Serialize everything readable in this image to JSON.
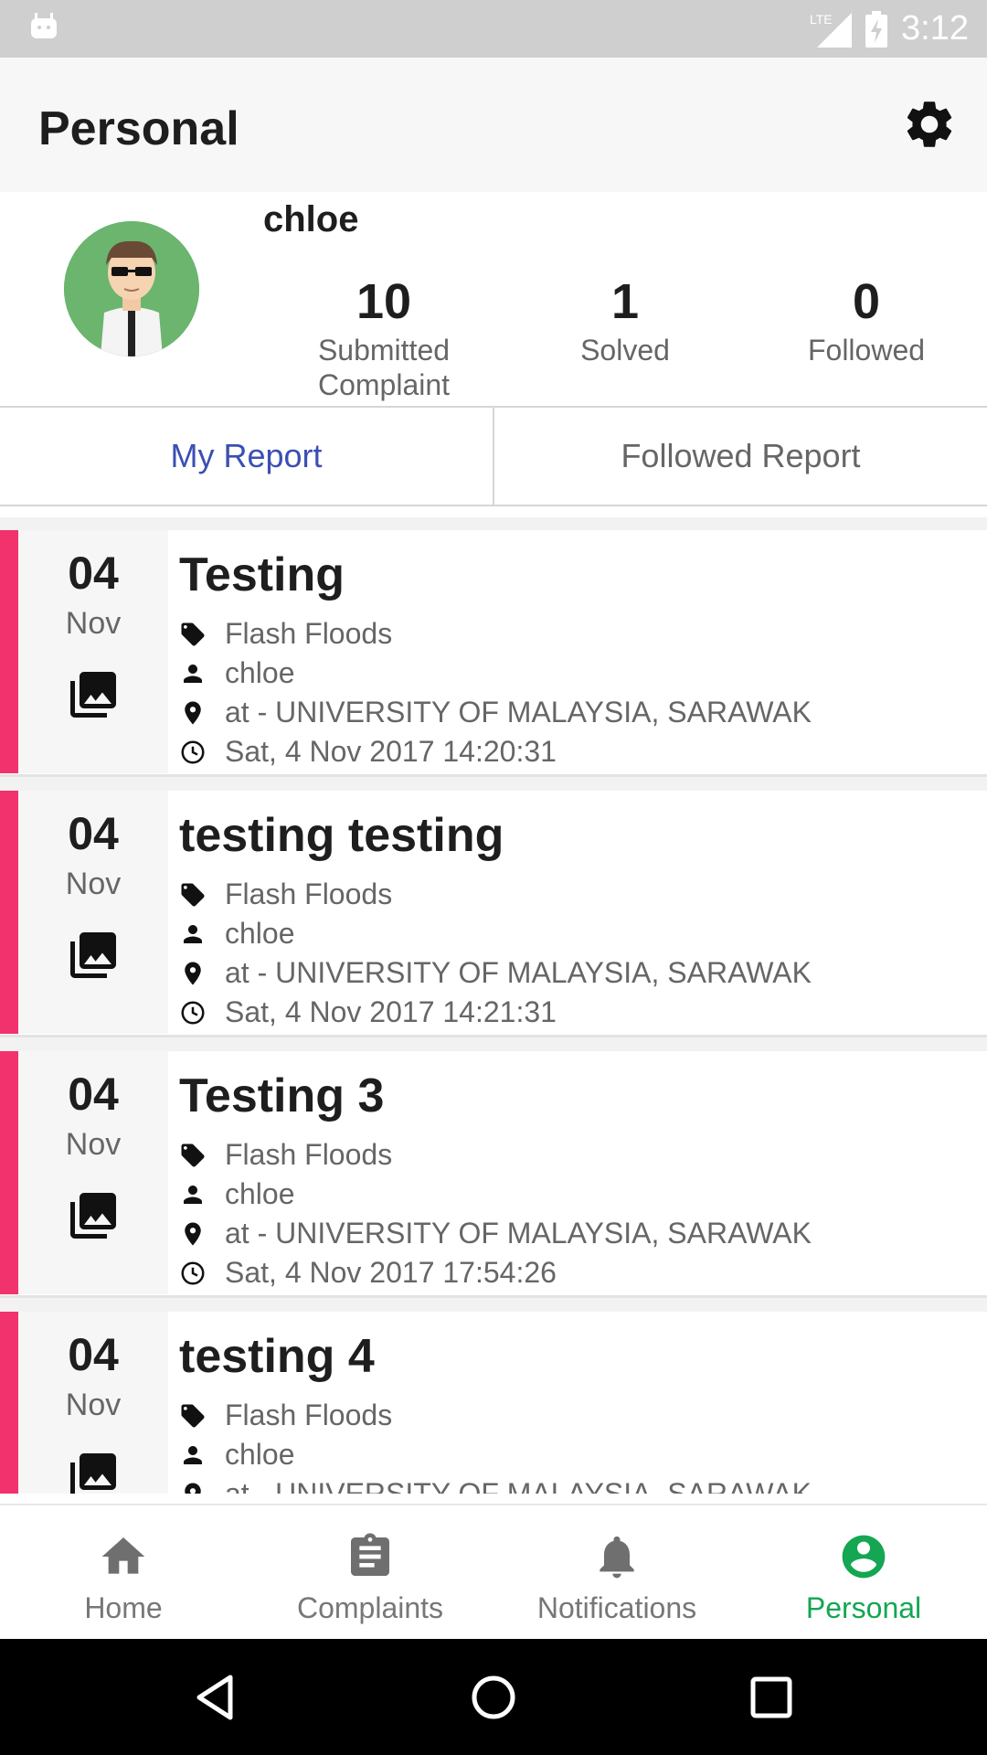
{
  "status_bar": {
    "network": "LTE",
    "time": "3:12"
  },
  "app_bar": {
    "title": "Personal"
  },
  "profile": {
    "username": "chloe",
    "stats": [
      {
        "value": "10",
        "label_line1": "Submitted",
        "label_line2": "Complaint"
      },
      {
        "value": "1",
        "label_line1": "Solved",
        "label_line2": ""
      },
      {
        "value": "0",
        "label_line1": "Followed",
        "label_line2": ""
      }
    ]
  },
  "tabs": [
    {
      "label": "My Report",
      "active": true
    },
    {
      "label": "Followed Report",
      "active": false
    }
  ],
  "reports": [
    {
      "day": "04",
      "month": "Nov",
      "title": "Testing",
      "category": "Flash Floods",
      "user": "chloe",
      "location": "at - UNIVERSITY OF MALAYSIA, SARAWAK",
      "datetime": "Sat, 4 Nov 2017 14:20:31"
    },
    {
      "day": "04",
      "month": "Nov",
      "title": "testing testing",
      "category": "Flash Floods",
      "user": "chloe",
      "location": "at - UNIVERSITY OF MALAYSIA, SARAWAK",
      "datetime": "Sat, 4 Nov 2017 14:21:31"
    },
    {
      "day": "04",
      "month": "Nov",
      "title": "Testing 3",
      "category": "Flash Floods",
      "user": "chloe",
      "location": "at - UNIVERSITY OF MALAYSIA, SARAWAK",
      "datetime": "Sat, 4 Nov 2017 17:54:26"
    },
    {
      "day": "04",
      "month": "Nov",
      "title": "testing 4",
      "category": "Flash Floods",
      "user": "chloe",
      "location": "at - UNIVERSITY OF MALAYSIA, SARAWAK",
      "datetime": ""
    }
  ],
  "bottom_nav": [
    {
      "label": "Home",
      "icon": "home-icon",
      "active": false
    },
    {
      "label": "Complaints",
      "icon": "clipboard-icon",
      "active": false
    },
    {
      "label": "Notifications",
      "icon": "bell-icon",
      "active": false
    },
    {
      "label": "Personal",
      "icon": "account-circle-icon",
      "active": true
    }
  ],
  "colors": {
    "accent_pink": "#f2326c",
    "active_tab": "#3b4fb3",
    "active_nav": "#14a652"
  }
}
